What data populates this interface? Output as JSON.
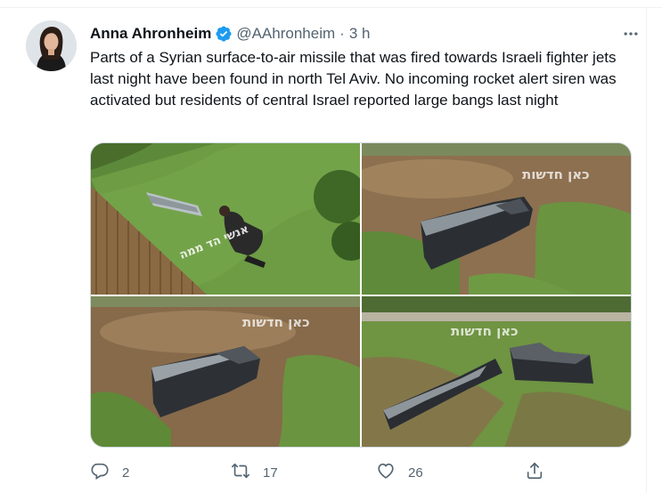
{
  "tweet": {
    "author_name": "Anna Ahronheim",
    "handle": "@AAhronheim",
    "separator": "·",
    "time": "3 h",
    "verified_icon": "verified-badge-icon",
    "more_icon": "more-horizontal-icon",
    "text": "Parts of a Syrian surface-to-air missile that was fired towards Israeli fighter jets last night have been found in north Tel Aviv. No incoming rocket alert siren was activated but residents of central Israel reported large bangs last night",
    "media": [
      {
        "kind": "photo",
        "watermark": "אנשי הד ממה"
      },
      {
        "kind": "photo",
        "watermark": "כאן חדשות"
      },
      {
        "kind": "photo",
        "watermark": "כאן חדשות"
      },
      {
        "kind": "photo",
        "watermark": "כאן חדשות"
      }
    ],
    "actions": {
      "reply": {
        "icon": "reply-icon",
        "count": "2"
      },
      "retweet": {
        "icon": "retweet-icon",
        "count": "17"
      },
      "like": {
        "icon": "heart-icon",
        "count": "26"
      },
      "share": {
        "icon": "share-icon"
      }
    }
  },
  "colors": {
    "text_primary": "#0f1419",
    "text_secondary": "#536471",
    "verified_blue": "#1d9bf0",
    "border": "#cfd9de"
  }
}
